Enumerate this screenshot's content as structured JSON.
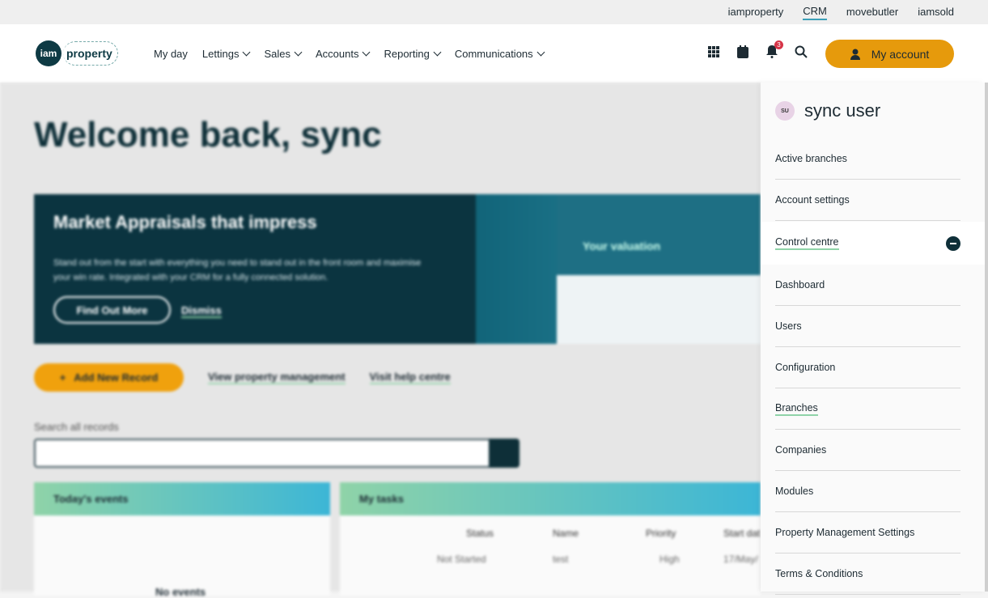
{
  "brands": {
    "items": [
      "iamproperty",
      "CRM",
      "movebutler",
      "iamsold"
    ],
    "active": "CRM"
  },
  "logo": {
    "mark": "iam",
    "word": "property"
  },
  "nav": {
    "items": [
      {
        "label": "My day",
        "dropdown": false
      },
      {
        "label": "Lettings",
        "dropdown": true
      },
      {
        "label": "Sales",
        "dropdown": true
      },
      {
        "label": "Accounts",
        "dropdown": true
      },
      {
        "label": "Reporting",
        "dropdown": true
      },
      {
        "label": "Communications",
        "dropdown": true
      }
    ],
    "notification_count": "3",
    "account_label": "My account",
    "icons": [
      "grid-icon",
      "calendar-icon",
      "bell-icon",
      "search-icon",
      "user-icon"
    ]
  },
  "page": {
    "welcome": "Welcome back, sync",
    "banner": {
      "title": "Market Appraisals that impress",
      "body": "Stand out from the start with everything you need to stand out in the front room and maximise your win rate. Integrated with your CRM for a fully connected solution.",
      "cta": "Find Out More",
      "dismiss": "Dismiss",
      "mock_heading": "Your valuation"
    },
    "add_record": "Add New Record",
    "view_pm": "View property management",
    "help": "Visit help centre",
    "search_label": "Search all records",
    "events_title": "Today's events",
    "no_events": "No events",
    "tasks_title": "My tasks",
    "task_columns": [
      "Status",
      "Name",
      "Priority",
      "Start dat"
    ],
    "task_row": {
      "status": "Not Started",
      "name": "test",
      "priority": "High",
      "start": "17/May/"
    }
  },
  "drawer": {
    "initials": "SU",
    "username": "sync user",
    "items": [
      "Active branches",
      "Account settings",
      "Control centre",
      "Dashboard",
      "Users",
      "Configuration",
      "Branches",
      "Companies",
      "Modules",
      "Property Management Settings",
      "Terms & Conditions"
    ]
  },
  "colors": {
    "accent": "#e69a0c",
    "dark": "#0e2f38",
    "underline": "#8fd3a8"
  }
}
